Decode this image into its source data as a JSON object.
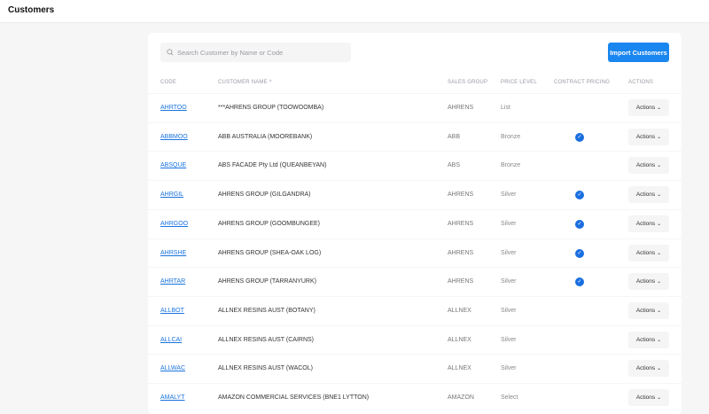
{
  "header": {
    "title": "Customers"
  },
  "search": {
    "placeholder": "Search Customer by Name or Code",
    "icon": "search-icon"
  },
  "import_label": "Import Customers",
  "columns": {
    "code": "CODE",
    "name": "CUSTOMER NAME",
    "sort": "^",
    "sales_group": "SALES GROUP",
    "price_level": "PRICE LEVEL",
    "contract": "CONTRACT PRICING",
    "actions": "ACTIONS"
  },
  "actions_label": "Actions",
  "rows": [
    {
      "code": "AHRTOO",
      "name": "***AHRENS GROUP (TOOWOOMBA)",
      "sales_group": "AHRENS",
      "price_level": "List",
      "contract": false
    },
    {
      "code": "ABBMOO",
      "name": "ABB AUSTRALIA (MOOREBANK)",
      "sales_group": "ABB",
      "price_level": "Bronze",
      "contract": true
    },
    {
      "code": "ABSQUE",
      "name": "ABS FACADE Pty Ltd (QUEANBEYAN)",
      "sales_group": "ABS",
      "price_level": "Bronze",
      "contract": false
    },
    {
      "code": "AHRGIL",
      "name": "AHRENS GROUP (GILGANDRA)",
      "sales_group": "AHRENS",
      "price_level": "Silver",
      "contract": true
    },
    {
      "code": "AHRGOO",
      "name": "AHRENS GROUP (GOOMBUNGEE)",
      "sales_group": "AHRENS",
      "price_level": "Silver",
      "contract": true
    },
    {
      "code": "AHRSHE",
      "name": "AHRENS GROUP (SHEA-OAK LOG)",
      "sales_group": "AHRENS",
      "price_level": "Silver",
      "contract": true
    },
    {
      "code": "AHRTAR",
      "name": "AHRENS GROUP (TARRANYURK)",
      "sales_group": "AHRENS",
      "price_level": "Silver",
      "contract": true
    },
    {
      "code": "ALLBOT",
      "name": "ALLNEX RESINS AUST (BOTANY)",
      "sales_group": "ALLNEX",
      "price_level": "Silver",
      "contract": false
    },
    {
      "code": "ALLCAI",
      "name": "ALLNEX RESINS AUST (CAIRNS)",
      "sales_group": "ALLNEX",
      "price_level": "Silver",
      "contract": false
    },
    {
      "code": "ALLWAC",
      "name": "ALLNEX RESINS AUST (WACOL)",
      "sales_group": "ALLNEX",
      "price_level": "Silver",
      "contract": false
    },
    {
      "code": "AMALYT",
      "name": "AMAZON COMMERCIAL SERVICES (BNE1 LYTTON)",
      "sales_group": "AMAZON",
      "price_level": "Select",
      "contract": false
    }
  ]
}
